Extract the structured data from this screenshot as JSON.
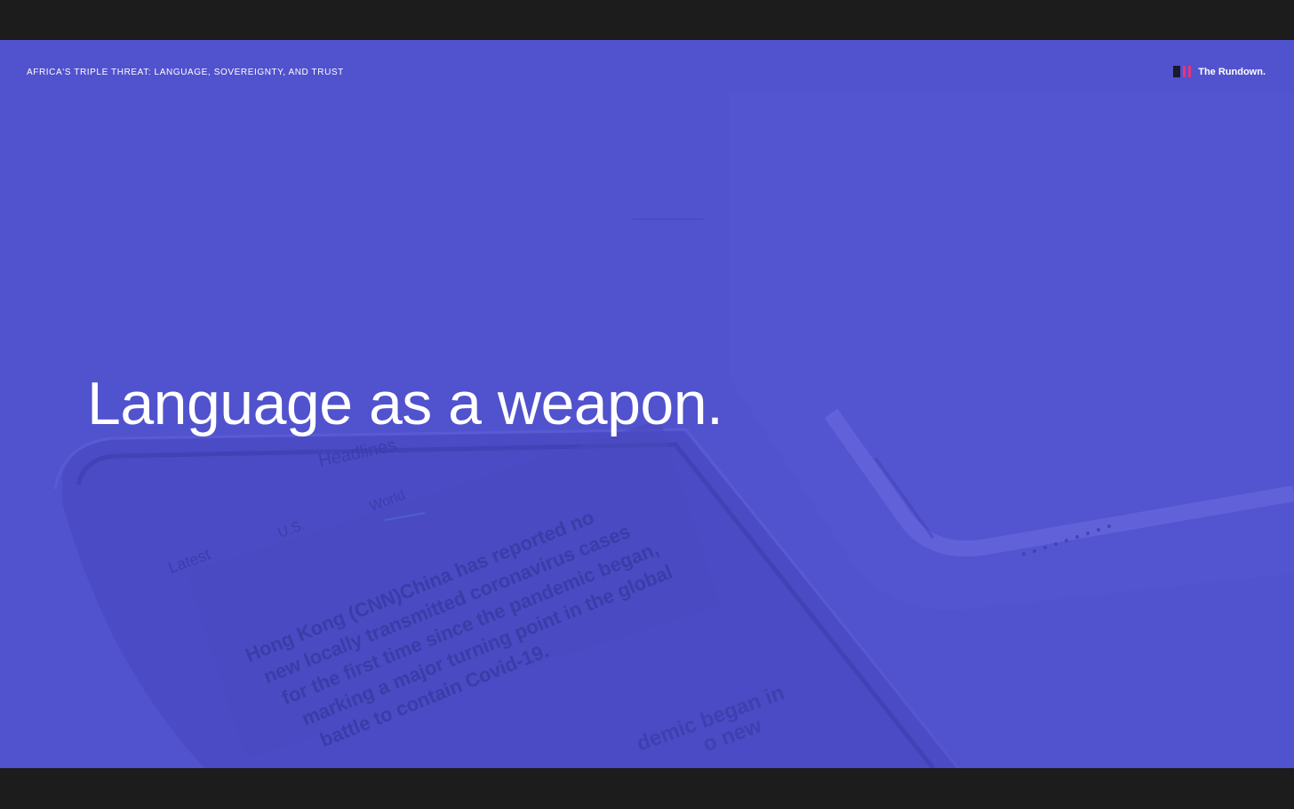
{
  "kicker": "AFRICA'S TRIPLE THREAT: LANGUAGE, SOVEREIGNTY, AND TRUST",
  "brand": {
    "name": "The Rundown.",
    "logo_icon": "rundown-logo-icon"
  },
  "headline": "Language as a weapon.",
  "background_photo": {
    "tabs": [
      "Latest",
      "U.S.",
      "World"
    ],
    "section_heading": "Headlines",
    "article_text": [
      "Hong Kong (CNN)China has reported no",
      "new locally transmitted coronavirus cases",
      "for the first time since the pandemic began,",
      "marking a major turning point in the global",
      "battle to contain Covid-19."
    ],
    "secondary_text": [
      "demic began in",
      "o new"
    ]
  },
  "colors": {
    "slide_bg": "#5152cd",
    "letterbox": "#1c1c1c",
    "accent_pink": "#e8357a",
    "text": "#ffffff"
  }
}
